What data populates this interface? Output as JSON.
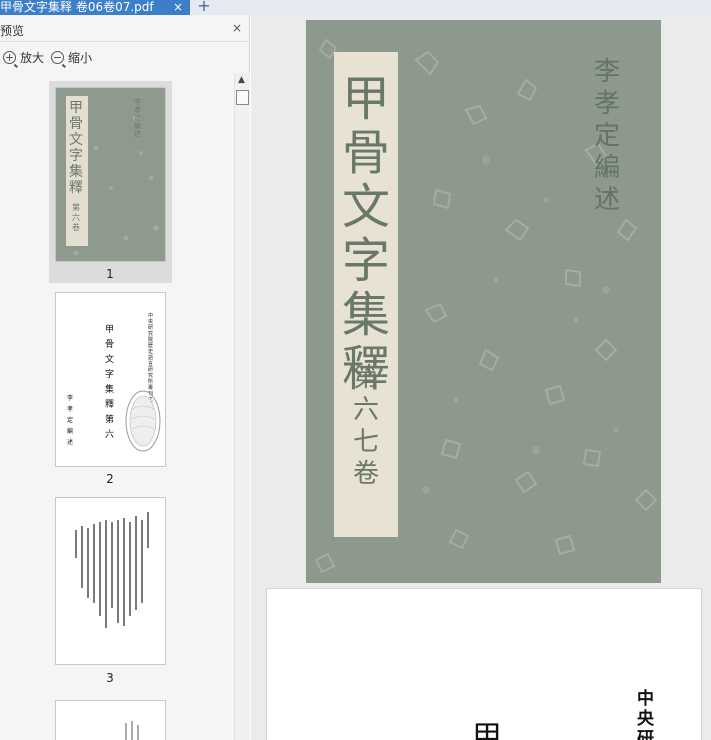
{
  "tabs": [
    {
      "label": "甲骨文字集释 卷06卷07.pdf",
      "close": "×"
    }
  ],
  "new_tab": "+",
  "sidebar": {
    "title": "预览",
    "close": "×",
    "zoom_in": "放大",
    "zoom_out": "缩小",
    "pages": [
      "1",
      "2",
      "3"
    ]
  },
  "thumb_texts": {
    "p1_title": "甲骨文字集釋",
    "p1_vol": "第六卷",
    "p2_title": "甲骨文字集釋第六",
    "p2_author": "李孝定編述",
    "p2_side": "中央研究院歷史語言研究所專刊之五十"
  },
  "cover": {
    "title": "甲骨文字集釋",
    "volume": "第六七卷",
    "inscription": "李孝定編述"
  },
  "page2": {
    "side_text": "中央研",
    "big_char": "甲"
  }
}
